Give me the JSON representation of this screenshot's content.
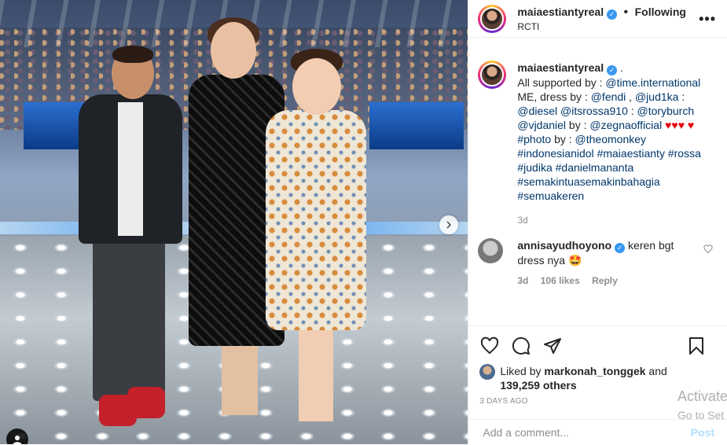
{
  "header": {
    "username": "maiaestiantyreal",
    "separator": "•",
    "follow_state": "Following",
    "location": "RCTI",
    "more": "•••"
  },
  "caption": {
    "username": "maiaestiantyreal",
    "suffix": " .",
    "segments": [
      {
        "t": "All supported by : ",
        "link": false
      },
      {
        "t": "@time.international",
        "link": true
      },
      {
        "t": " ME, dress by : ",
        "link": false
      },
      {
        "t": "@fendi",
        "link": true
      },
      {
        "t": " , ",
        "link": false
      },
      {
        "t": "@jud1ka",
        "link": true
      },
      {
        "t": " : ",
        "link": false
      },
      {
        "t": "@diesel",
        "link": true
      },
      {
        "t": " ",
        "link": false
      },
      {
        "t": "@itsrossa910",
        "link": true
      },
      {
        "t": " : ",
        "link": false
      },
      {
        "t": "@toryburch",
        "link": true
      },
      {
        "t": " ",
        "link": false
      },
      {
        "t": "@vjdaniel",
        "link": true
      },
      {
        "t": " by : ",
        "link": false
      },
      {
        "t": "@zegnaofficial",
        "link": true
      },
      {
        "t": " ♥♥♥ ♥ ",
        "link": false,
        "heart": true
      },
      {
        "t": "#photo",
        "link": true
      },
      {
        "t": " by : ",
        "link": false
      },
      {
        "t": "@theomonkey",
        "link": true
      },
      {
        "t": " ",
        "link": false
      },
      {
        "t": "#indonesianidol",
        "link": true
      },
      {
        "t": " ",
        "link": false
      },
      {
        "t": "#maiaestianty",
        "link": true
      },
      {
        "t": " ",
        "link": false
      },
      {
        "t": "#rossa",
        "link": true
      },
      {
        "t": " ",
        "link": false
      },
      {
        "t": "#judika",
        "link": true
      },
      {
        "t": " ",
        "link": false
      },
      {
        "t": "#danielmananta",
        "link": true
      },
      {
        "t": " ",
        "link": false
      },
      {
        "t": "#semakintuasemakinbahagia",
        "link": true
      },
      {
        "t": " ",
        "link": false
      },
      {
        "t": "#semuakeren",
        "link": true
      }
    ],
    "age": "3d"
  },
  "comment": {
    "username": "annisayudhoyono",
    "text": " keren bgt dress nya 🤩",
    "age": "3d",
    "likes": "106 likes",
    "reply": "Reply"
  },
  "likes": {
    "prefix": "Liked by ",
    "user": "markonah_tonggek",
    "mid": " and ",
    "others": "139,259 others"
  },
  "date": "3 DAYS AGO",
  "composer": {
    "placeholder": "Add a comment...",
    "post_label": "Post"
  },
  "watermark": {
    "line1": "Activate",
    "line2": "Go to Set"
  },
  "colors": {
    "link": "#00376b",
    "verified": "#3897f0",
    "heart": "#e3000f",
    "post_disabled": "#b2dffc"
  }
}
